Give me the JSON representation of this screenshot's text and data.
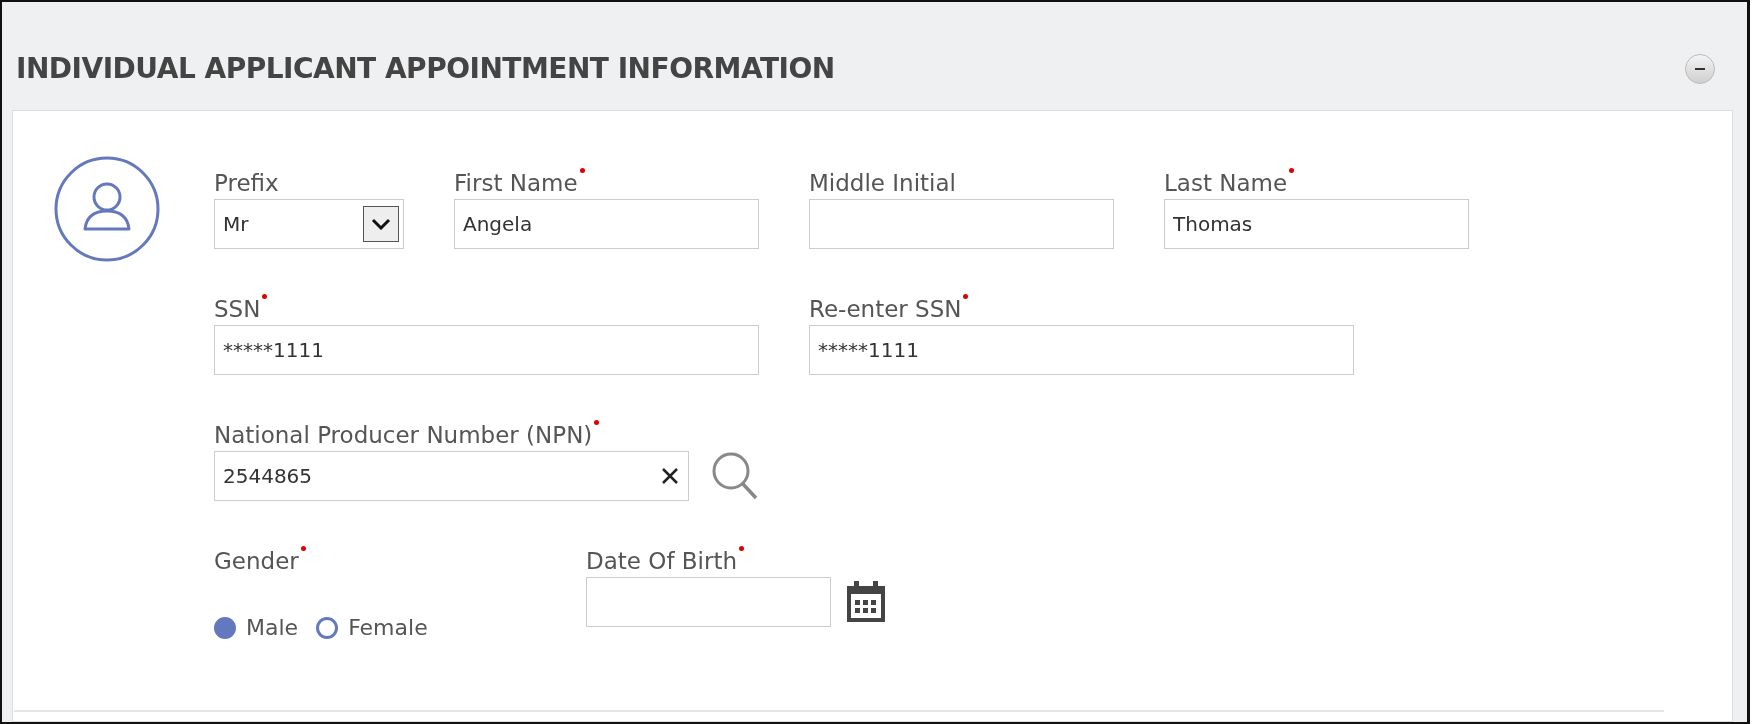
{
  "panel": {
    "title": "INDIVIDUAL APPLICANT APPOINTMENT INFORMATION",
    "collapsed": false
  },
  "rows": [
    [
      {
        "kind": "select",
        "label": "Prefix",
        "value": "Mr"
      },
      {
        "kind": "text",
        "label": "First Name",
        "required": true,
        "value": "Angela"
      },
      {
        "kind": "text",
        "label": "Middle Initial"
      },
      {
        "kind": "text",
        "label": "Last Name",
        "required": true,
        "value": "Thomas"
      }
    ],
    [
      {
        "kind": "wide",
        "label": "SSN",
        "required": true,
        "value": "*****1111"
      },
      {
        "kind": "wide",
        "label": "Re-enter SSN",
        "required": true,
        "value": "*****1111"
      }
    ],
    [
      {
        "kind": "search",
        "label": "National Producer Number (NPN)",
        "required": true,
        "value": "2544865"
      }
    ],
    [
      {
        "kind": "radio",
        "label": "Gender",
        "required": true,
        "options": [
          {
            "label": "Male",
            "selected": true
          },
          {
            "label": "Female",
            "selected": false
          }
        ]
      },
      {
        "kind": "date",
        "label": "Date Of Birth",
        "required": true
      }
    ]
  ]
}
